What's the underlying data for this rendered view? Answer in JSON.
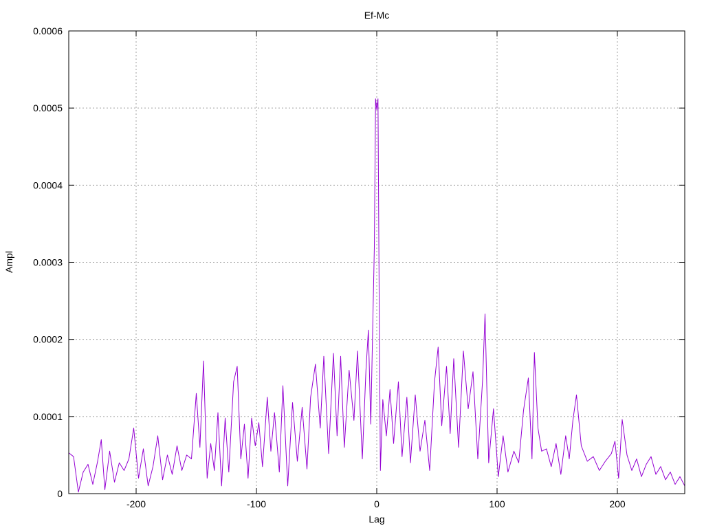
{
  "chart_data": {
    "type": "line",
    "title": "Ef-Mc",
    "xlabel": "Lag",
    "ylabel": "Ampl",
    "xlim": [
      -256,
      256
    ],
    "ylim": [
      0,
      0.0006
    ],
    "x_ticks": [
      -200,
      -100,
      0,
      100,
      200
    ],
    "x_tick_labels": [
      "-200",
      "-100",
      "0",
      "100",
      "200"
    ],
    "y_ticks": [
      0,
      0.0001,
      0.0002,
      0.0003,
      0.0004,
      0.0005,
      0.0006
    ],
    "y_tick_labels": [
      "0",
      "0.0001",
      "0.0002",
      "0.0003",
      "0.0004",
      "0.0005",
      "0.0006"
    ],
    "grid": true,
    "line_color": "#9400d3",
    "series": [
      {
        "points": [
          [
            -256,
            5.3e-05
          ],
          [
            -252,
            4.8e-05
          ],
          [
            -248,
            2e-06
          ],
          [
            -244,
            2.8e-05
          ],
          [
            -240,
            3.8e-05
          ],
          [
            -236,
            1.2e-05
          ],
          [
            -232,
            4.2e-05
          ],
          [
            -229,
            7e-05
          ],
          [
            -226,
            5e-06
          ],
          [
            -222,
            5.5e-05
          ],
          [
            -218,
            1.5e-05
          ],
          [
            -214,
            4e-05
          ],
          [
            -210,
            3e-05
          ],
          [
            -206,
            4.5e-05
          ],
          [
            -202,
            8.5e-05
          ],
          [
            -198,
            2e-05
          ],
          [
            -194,
            5.8e-05
          ],
          [
            -190,
            1e-05
          ],
          [
            -186,
            3.5e-05
          ],
          [
            -182,
            7.5e-05
          ],
          [
            -178,
            1.8e-05
          ],
          [
            -174,
            5e-05
          ],
          [
            -170,
            2.5e-05
          ],
          [
            -166,
            6.2e-05
          ],
          [
            -162,
            3e-05
          ],
          [
            -158,
            5e-05
          ],
          [
            -154,
            4.5e-05
          ],
          [
            -150,
            0.00013
          ],
          [
            -147,
            6e-05
          ],
          [
            -144,
            0.000172
          ],
          [
            -141,
            2e-05
          ],
          [
            -138,
            6.5e-05
          ],
          [
            -135,
            3e-05
          ],
          [
            -132,
            0.000105
          ],
          [
            -129,
            1e-05
          ],
          [
            -126,
            9.8e-05
          ],
          [
            -123,
            2.8e-05
          ],
          [
            -119,
            0.000145
          ],
          [
            -116,
            0.000165
          ],
          [
            -113,
            4.5e-05
          ],
          [
            -110,
            9e-05
          ],
          [
            -107,
            2e-05
          ],
          [
            -104,
            9.8e-05
          ],
          [
            -101,
            6.2e-05
          ],
          [
            -98,
            9.2e-05
          ],
          [
            -95,
            3.5e-05
          ],
          [
            -91,
            0.000125
          ],
          [
            -88,
            5.5e-05
          ],
          [
            -85,
            0.000105
          ],
          [
            -81,
            2.8e-05
          ],
          [
            -78,
            0.00014
          ],
          [
            -74,
            1e-05
          ],
          [
            -70,
            0.000118
          ],
          [
            -66,
            4.2e-05
          ],
          [
            -62,
            0.000112
          ],
          [
            -58,
            3.2e-05
          ],
          [
            -55,
            0.000125
          ],
          [
            -51,
            0.000168
          ],
          [
            -47,
            8.5e-05
          ],
          [
            -44,
            0.000178
          ],
          [
            -40,
            5.2e-05
          ],
          [
            -36,
            0.000182
          ],
          [
            -33,
            7.5e-05
          ],
          [
            -30,
            0.000178
          ],
          [
            -27,
            6e-05
          ],
          [
            -23,
            0.00016
          ],
          [
            -19,
            9.5e-05
          ],
          [
            -16,
            0.000185
          ],
          [
            -12,
            4.5e-05
          ],
          [
            -9,
            0.00016
          ],
          [
            -7,
            0.000212
          ],
          [
            -5,
            9e-05
          ],
          [
            -3,
            0.000245
          ],
          [
            -2,
            0.00032
          ],
          [
            -1,
            0.000512
          ],
          [
            0,
            0.000498
          ],
          [
            1,
            0.000512
          ],
          [
            2,
            0.000258
          ],
          [
            3,
            3e-05
          ],
          [
            5,
            0.000122
          ],
          [
            8,
            7.5e-05
          ],
          [
            11,
            0.000135
          ],
          [
            14,
            6.5e-05
          ],
          [
            18,
            0.000145
          ],
          [
            21,
            4.8e-05
          ],
          [
            25,
            0.000125
          ],
          [
            28,
            4e-05
          ],
          [
            32,
            0.000128
          ],
          [
            36,
            5.5e-05
          ],
          [
            40,
            9.5e-05
          ],
          [
            44,
            3e-05
          ],
          [
            48,
            0.000145
          ],
          [
            51,
            0.00019
          ],
          [
            54,
            8.8e-05
          ],
          [
            58,
            0.000165
          ],
          [
            61,
            7.8e-05
          ],
          [
            64,
            0.000175
          ],
          [
            68,
            6e-05
          ],
          [
            72,
            0.000185
          ],
          [
            76,
            0.00011
          ],
          [
            80,
            0.000158
          ],
          [
            84,
            4.5e-05
          ],
          [
            88,
            0.000148
          ],
          [
            90,
            0.000233
          ],
          [
            93,
            4e-05
          ],
          [
            97,
            0.00011
          ],
          [
            101,
            2.2e-05
          ],
          [
            105,
            7.5e-05
          ],
          [
            109,
            2.8e-05
          ],
          [
            114,
            5.5e-05
          ],
          [
            118,
            4e-05
          ],
          [
            122,
            0.000108
          ],
          [
            126,
            0.00015
          ],
          [
            129,
            4.5e-05
          ],
          [
            131,
            0.000183
          ],
          [
            134,
            8.5e-05
          ],
          [
            137,
            5.5e-05
          ],
          [
            141,
            5.8e-05
          ],
          [
            145,
            3.5e-05
          ],
          [
            149,
            6.5e-05
          ],
          [
            153,
            2.5e-05
          ],
          [
            157,
            7.5e-05
          ],
          [
            160,
            4.5e-05
          ],
          [
            163,
            9.5e-05
          ],
          [
            166,
            0.000128
          ],
          [
            170,
            6.2e-05
          ],
          [
            175,
            4.2e-05
          ],
          [
            180,
            4.8e-05
          ],
          [
            185,
            3e-05
          ],
          [
            190,
            4.2e-05
          ],
          [
            195,
            5.2e-05
          ],
          [
            198,
            6.8e-05
          ],
          [
            201,
            2e-05
          ],
          [
            204,
            9.6e-05
          ],
          [
            208,
            5e-05
          ],
          [
            212,
            3e-05
          ],
          [
            216,
            4.5e-05
          ],
          [
            220,
            2.2e-05
          ],
          [
            224,
            3.8e-05
          ],
          [
            228,
            4.8e-05
          ],
          [
            232,
            2.5e-05
          ],
          [
            236,
            3.5e-05
          ],
          [
            240,
            1.8e-05
          ],
          [
            244,
            2.8e-05
          ],
          [
            248,
            1.2e-05
          ],
          [
            252,
            2.2e-05
          ],
          [
            256,
            1e-05
          ]
        ]
      }
    ]
  }
}
